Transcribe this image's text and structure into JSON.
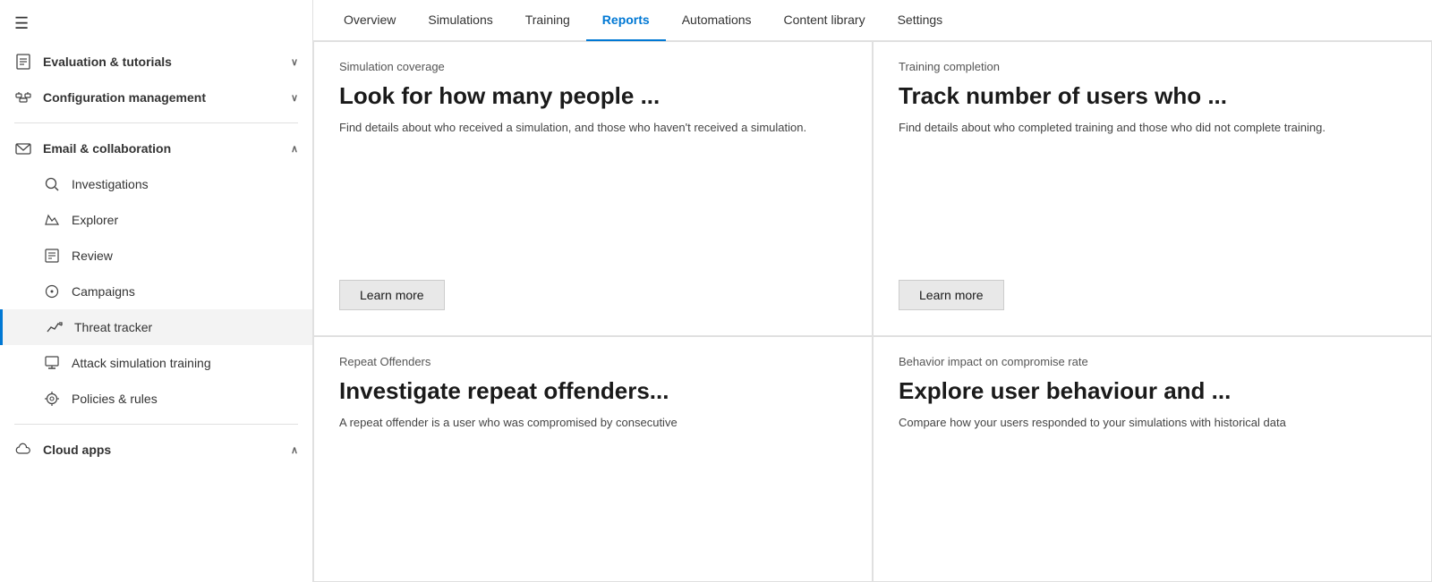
{
  "sidebar": {
    "hamburger": "☰",
    "items": [
      {
        "id": "evaluation-tutorials",
        "label": "Evaluation & tutorials",
        "icon": "📋",
        "expandable": true,
        "expanded": false
      },
      {
        "id": "configuration-management",
        "label": "Configuration management",
        "icon": "⚙",
        "expandable": true,
        "expanded": false
      },
      {
        "id": "email-collaboration",
        "label": "Email & collaboration",
        "icon": "✉",
        "expandable": true,
        "expanded": true,
        "bold": true
      },
      {
        "id": "investigations",
        "label": "Investigations",
        "icon": "🔍",
        "indent": true
      },
      {
        "id": "explorer",
        "label": "Explorer",
        "icon": "🗂",
        "indent": true
      },
      {
        "id": "review",
        "label": "Review",
        "icon": "📄",
        "indent": true
      },
      {
        "id": "campaigns",
        "label": "Campaigns",
        "icon": "🎯",
        "indent": true
      },
      {
        "id": "threat-tracker",
        "label": "Threat tracker",
        "icon": "📈",
        "indent": true,
        "active": true
      },
      {
        "id": "attack-simulation",
        "label": "Attack simulation training",
        "icon": "🖥",
        "indent": true
      },
      {
        "id": "policies-rules",
        "label": "Policies & rules",
        "icon": "⚙",
        "indent": true
      },
      {
        "id": "cloud-apps",
        "label": "Cloud apps",
        "icon": "☁",
        "expandable": true,
        "expanded": true,
        "bold": true
      }
    ]
  },
  "tabs": {
    "items": [
      {
        "id": "overview",
        "label": "Overview",
        "active": false
      },
      {
        "id": "simulations",
        "label": "Simulations",
        "active": false
      },
      {
        "id": "training",
        "label": "Training",
        "active": false
      },
      {
        "id": "reports",
        "label": "Reports",
        "active": true
      },
      {
        "id": "automations",
        "label": "Automations",
        "active": false
      },
      {
        "id": "content-library",
        "label": "Content library",
        "active": false
      },
      {
        "id": "settings",
        "label": "Settings",
        "active": false
      }
    ]
  },
  "cards": [
    {
      "id": "simulation-coverage",
      "label": "Simulation coverage",
      "title": "Look for how many people ...",
      "desc": "Find details about who received a simulation, and those who haven't received a simulation.",
      "learn_more": "Learn more"
    },
    {
      "id": "training-completion",
      "label": "Training completion",
      "title": "Track number of users who ...",
      "desc": "Find details about who completed training and those who did not complete training.",
      "learn_more": "Learn more"
    },
    {
      "id": "repeat-offenders",
      "label": "Repeat Offenders",
      "title": "Investigate repeat offenders...",
      "desc": "A repeat offender is a user who was compromised by consecutive",
      "learn_more": null
    },
    {
      "id": "behavior-impact",
      "label": "Behavior impact on compromise rate",
      "title": "Explore user behaviour and ...",
      "desc": "Compare how your users responded to your simulations with historical data",
      "learn_more": null
    }
  ]
}
